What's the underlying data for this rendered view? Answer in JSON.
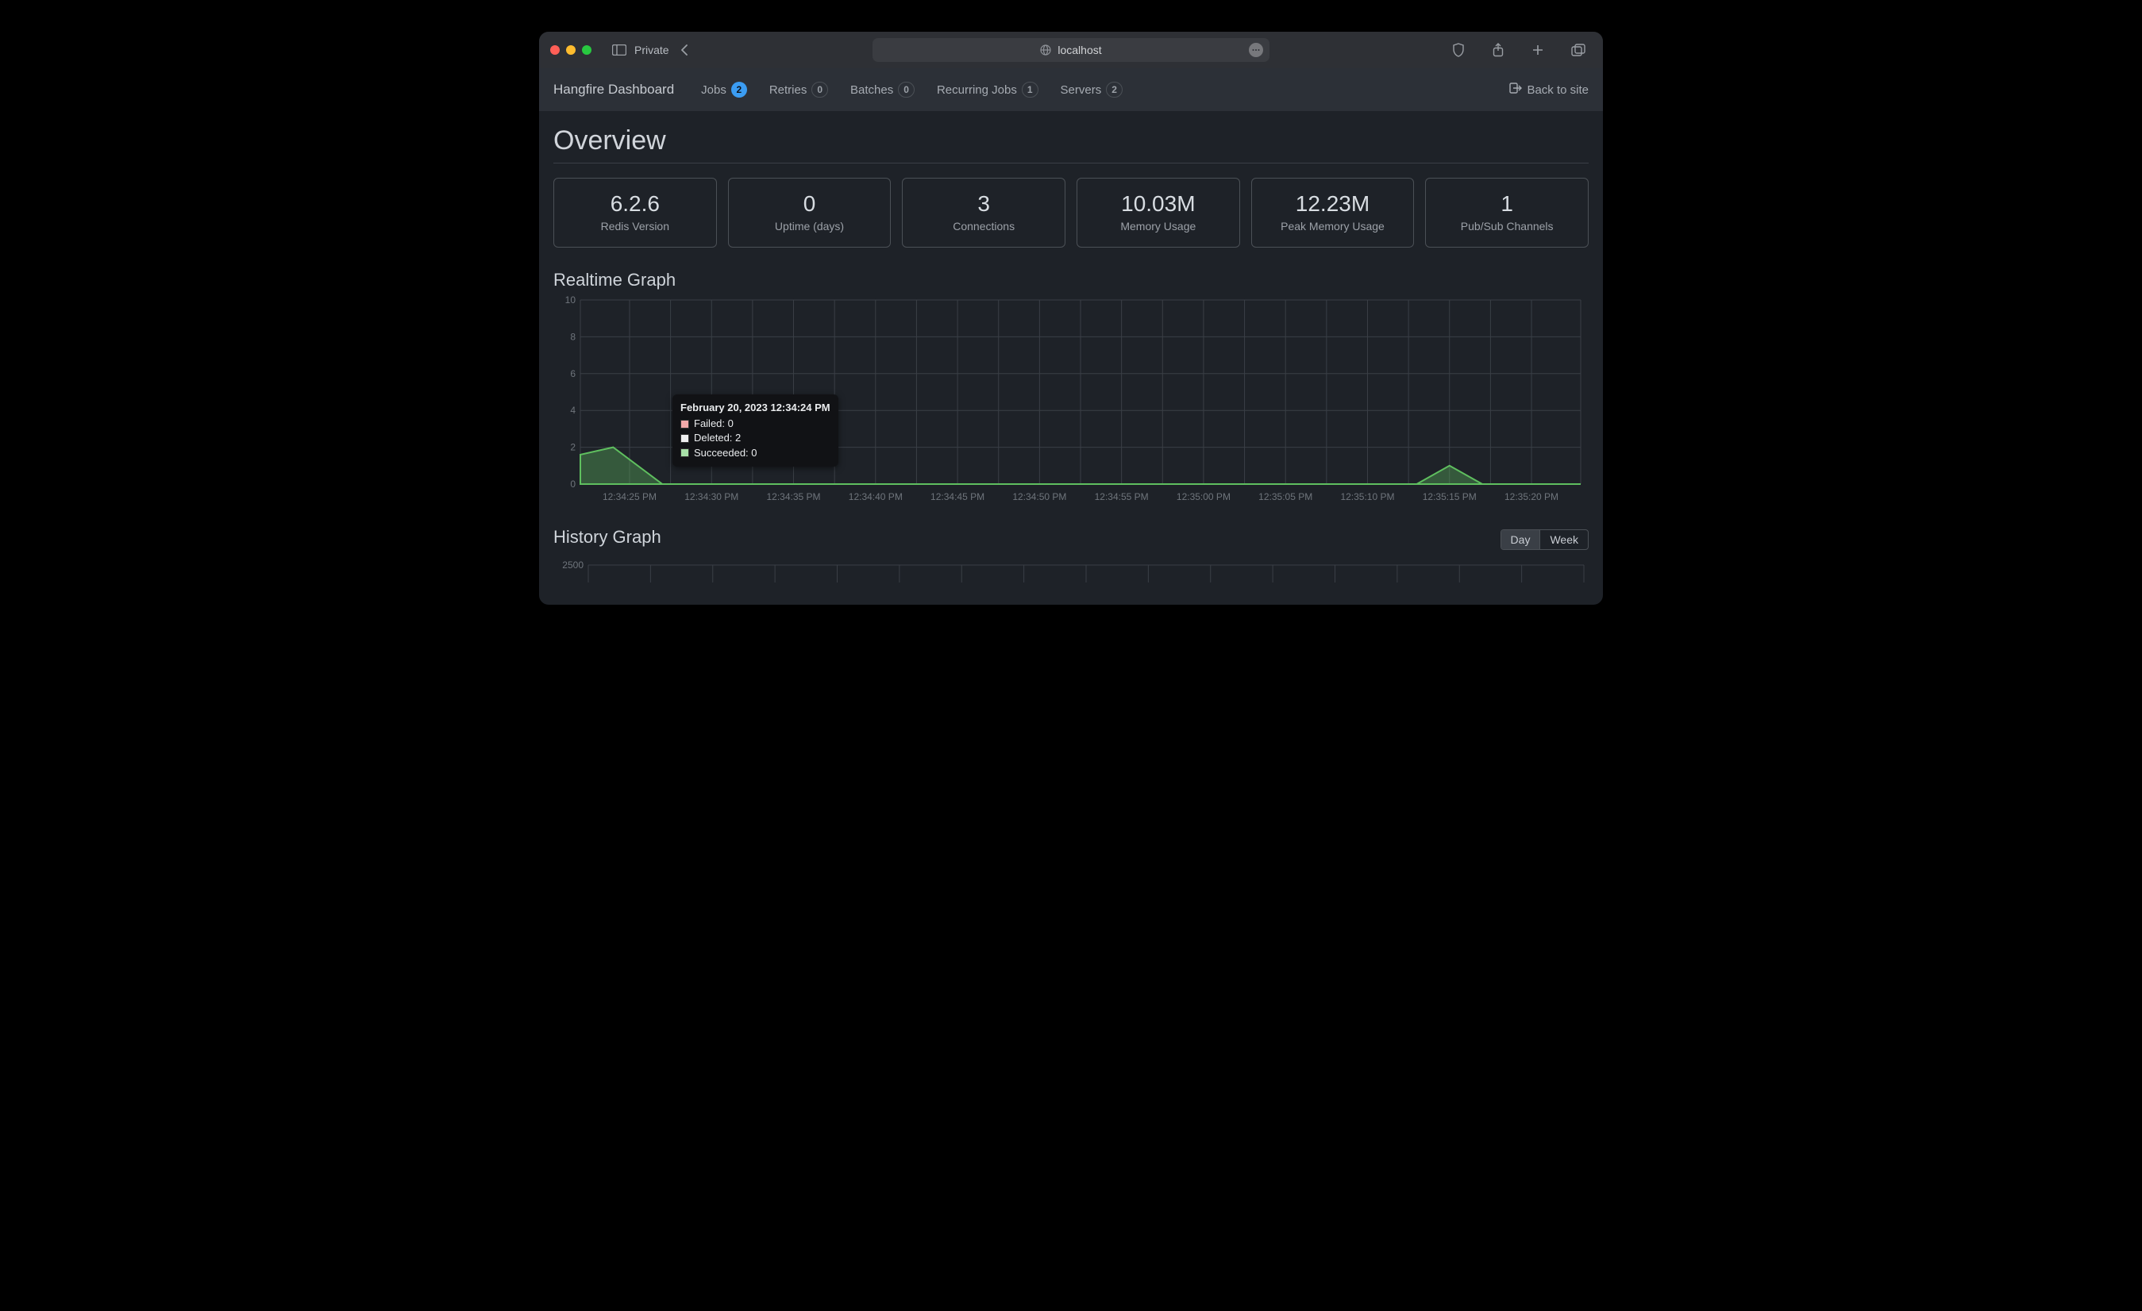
{
  "browser": {
    "private_label": "Private",
    "address": "localhost"
  },
  "nav": {
    "brand": "Hangfire Dashboard",
    "items": [
      {
        "label": "Jobs",
        "badge": "2",
        "badge_style": "blue"
      },
      {
        "label": "Retries",
        "badge": "0",
        "badge_style": "dim"
      },
      {
        "label": "Batches",
        "badge": "0",
        "badge_style": "dim"
      },
      {
        "label": "Recurring Jobs",
        "badge": "1",
        "badge_style": "dim"
      },
      {
        "label": "Servers",
        "badge": "2",
        "badge_style": "dim"
      }
    ],
    "back_to_site": "Back to site"
  },
  "page_title": "Overview",
  "metrics": [
    {
      "value": "6.2.6",
      "label": "Redis Version"
    },
    {
      "value": "0",
      "label": "Uptime (days)"
    },
    {
      "value": "3",
      "label": "Connections"
    },
    {
      "value": "10.03M",
      "label": "Memory Usage"
    },
    {
      "value": "12.23M",
      "label": "Peak Memory Usage"
    },
    {
      "value": "1",
      "label": "Pub/Sub Channels"
    }
  ],
  "realtime": {
    "title": "Realtime Graph",
    "tooltip": {
      "timestamp": "February 20, 2023 12:34:24 PM",
      "failed_label": "Failed: 0",
      "deleted_label": "Deleted: 2",
      "succeeded_label": "Succeeded: 0"
    }
  },
  "history": {
    "title": "History Graph",
    "segments": {
      "day": "Day",
      "week": "Week"
    },
    "y_top_tick": "2500"
  },
  "chart_data": [
    {
      "type": "area",
      "title": "Realtime Graph",
      "xlabel": "",
      "ylabel": "",
      "ylim": [
        0,
        10
      ],
      "y_ticks": [
        0,
        2,
        4,
        6,
        8,
        10
      ],
      "x_ticks": [
        "12:34:25 PM",
        "12:34:30 PM",
        "12:34:35 PM",
        "12:34:40 PM",
        "12:34:45 PM",
        "12:34:50 PM",
        "12:34:55 PM",
        "12:35:00 PM",
        "12:35:05 PM",
        "12:35:10 PM",
        "12:35:15 PM",
        "12:35:20 PM"
      ],
      "series": [
        {
          "name": "Deleted",
          "x": [
            "12:34:22 PM",
            "12:34:24 PM",
            "12:34:27 PM",
            "12:34:30 PM",
            "12:34:35 PM",
            "12:34:40 PM",
            "12:34:45 PM",
            "12:34:50 PM",
            "12:34:55 PM",
            "12:35:00 PM",
            "12:35:05 PM",
            "12:35:10 PM",
            "12:35:13 PM",
            "12:35:15 PM",
            "12:35:17 PM",
            "12:35:20 PM",
            "12:35:23 PM"
          ],
          "values": [
            1.6,
            2.0,
            0,
            0,
            0,
            0,
            0,
            0,
            0,
            0,
            0,
            0,
            0,
            1.0,
            0,
            0,
            0
          ]
        }
      ],
      "tooltip_point": {
        "x": "12:34:24 PM",
        "Failed": 0,
        "Deleted": 2,
        "Succeeded": 0
      }
    },
    {
      "type": "line",
      "title": "History Graph",
      "ylim": [
        0,
        2500
      ],
      "y_ticks": [
        2500
      ],
      "x_ticks": [],
      "series": []
    }
  ]
}
